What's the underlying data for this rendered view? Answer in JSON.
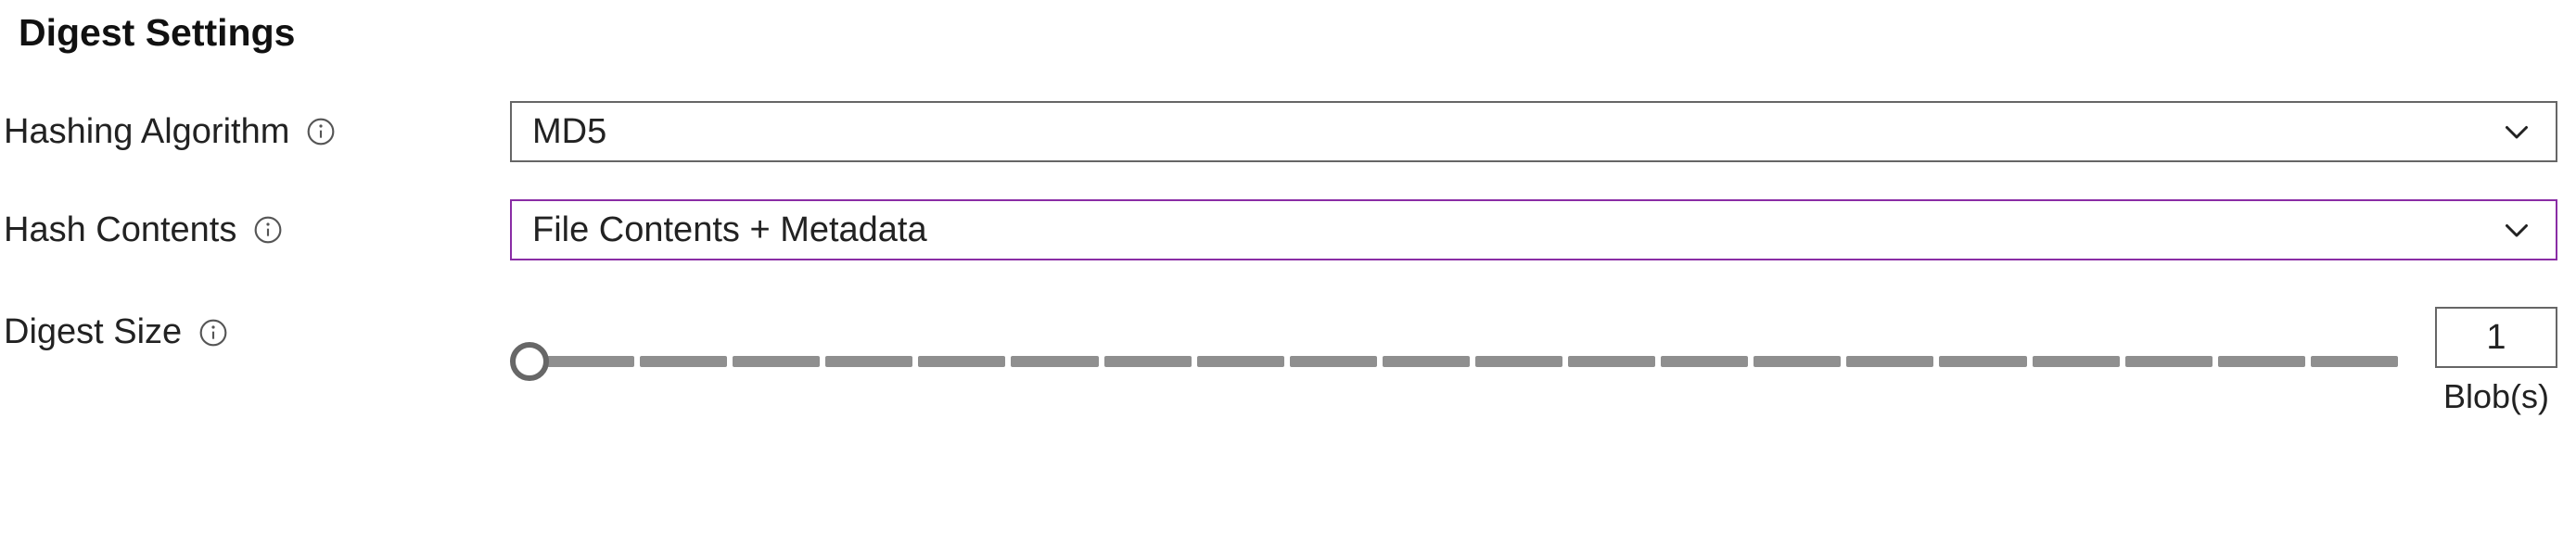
{
  "section": {
    "title": "Digest Settings"
  },
  "fields": {
    "algorithm": {
      "label": "Hashing Algorithm",
      "value": "MD5"
    },
    "contents": {
      "label": "Hash Contents",
      "value": "File Contents + Metadata"
    },
    "size": {
      "label": "Digest Size",
      "value": "1",
      "unit": "Blob(s)",
      "tickCount": 20
    }
  },
  "colors": {
    "accent": "#8a2da5",
    "border": "#666666",
    "track": "#8f8f8f"
  }
}
